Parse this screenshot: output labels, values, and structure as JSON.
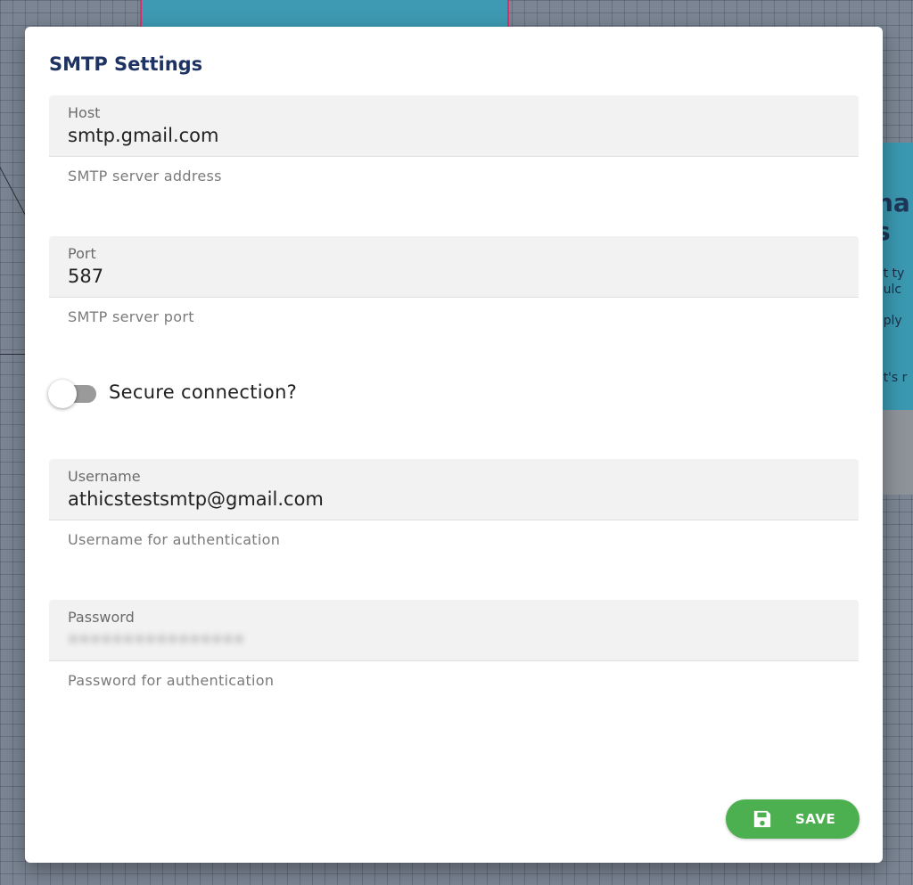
{
  "background": {
    "card_right_heading": "ha\ns",
    "card_right_line1": "at ty\noulc",
    "card_right_line2": "eply",
    "card_right_line3": "ot's r"
  },
  "modal": {
    "title": "SMTP Settings",
    "fields": [
      {
        "label": "Host",
        "value": "smtp.gmail.com",
        "helper": "SMTP server address"
      },
      {
        "label": "Port",
        "value": "587",
        "helper": "SMTP server port"
      },
      {
        "label": "Username",
        "value": "athicstestsmtp@gmail.com",
        "helper": "Username for authentication"
      },
      {
        "label": "Password",
        "value": "••••••••••••••••",
        "helper": "Password for authentication"
      }
    ],
    "toggle": {
      "label": "Secure connection?",
      "checked": false
    },
    "save_label": "SAVE"
  },
  "colors": {
    "title": "#1f3363",
    "save_button": "#4caf50",
    "field_bg": "#f2f2f2"
  },
  "icons": {
    "save": "floppy-disk-icon"
  }
}
